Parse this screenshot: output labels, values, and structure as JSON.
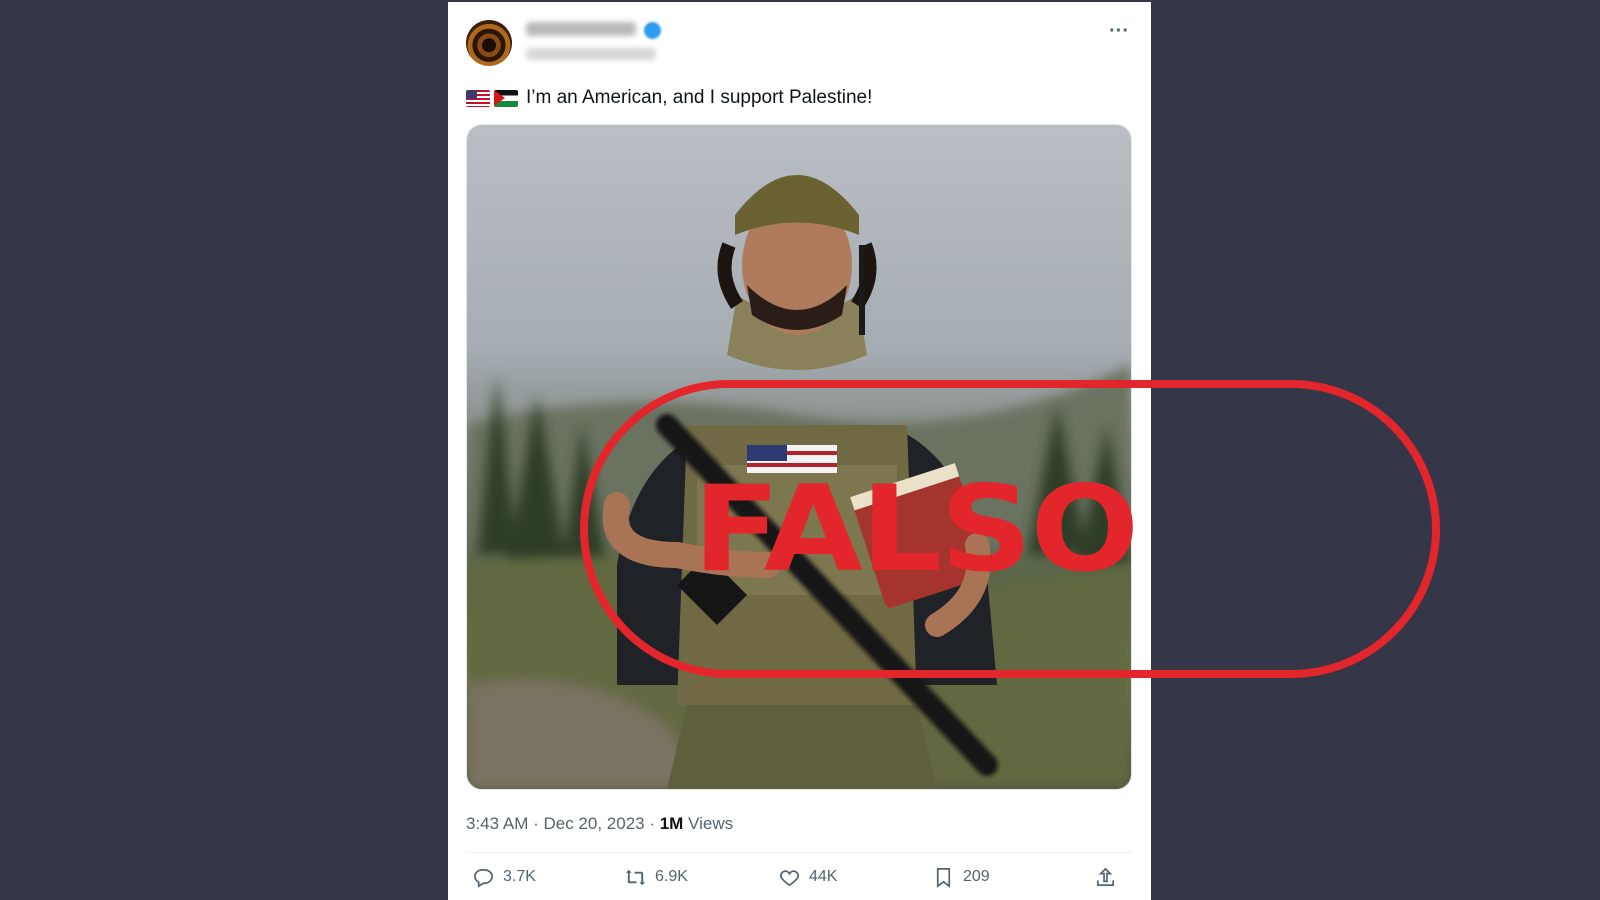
{
  "tweet": {
    "text": "I’m an American, and I support Palestine!",
    "flags": [
      "flag-us-icon",
      "flag-palestine-icon"
    ],
    "time": "3:43 AM · Dec 20, 2023 · ",
    "views_count": "1M",
    "views_label": " Views"
  },
  "actions": {
    "replies": "3.7K",
    "reposts": "6.9K",
    "likes": "44K",
    "bookmarks": "209"
  },
  "stamp": {
    "text": "FALSO",
    "color": "#e3262b"
  },
  "colors": {
    "background": "#363649",
    "muted_text": "#536471"
  }
}
